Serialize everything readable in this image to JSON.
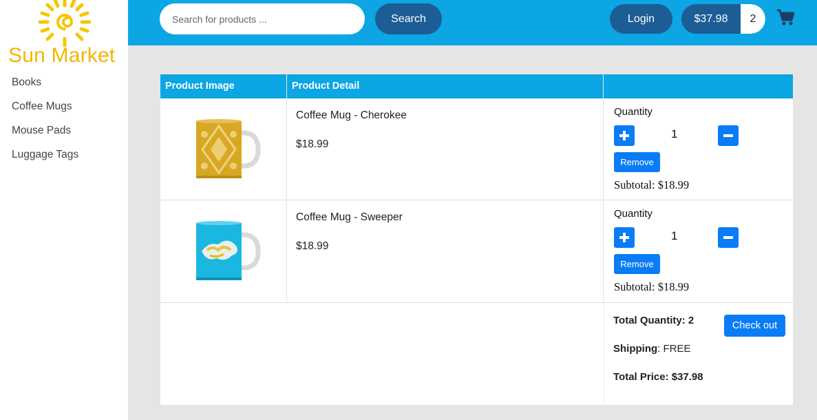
{
  "brand": {
    "name": "Sun Market",
    "logo_icon": "sun-icon",
    "color": "#f2b600"
  },
  "sidebar": {
    "items": [
      {
        "label": "Books"
      },
      {
        "label": "Coffee Mugs"
      },
      {
        "label": "Mouse Pads"
      },
      {
        "label": "Luggage Tags"
      }
    ]
  },
  "header": {
    "background": "#0ba6e3",
    "search": {
      "placeholder": "Search for products ...",
      "value": ""
    },
    "search_button": "Search",
    "login_button": "Login",
    "cart": {
      "total": "$37.98",
      "count": "2",
      "icon": "shopping-cart-icon"
    }
  },
  "table": {
    "headers": [
      "Product Image",
      "Product Detail",
      ""
    ],
    "rows": [
      {
        "image": "mug-cherokee-image",
        "name": "Coffee Mug - Cherokee",
        "price": "$18.99",
        "quantity_label": "Quantity",
        "quantity": "1",
        "remove_label": "Remove",
        "subtotal": "Subtotal: $18.99"
      },
      {
        "image": "mug-sweeper-image",
        "name": "Coffee Mug - Sweeper",
        "price": "$18.99",
        "quantity_label": "Quantity",
        "quantity": "1",
        "remove_label": "Remove",
        "subtotal": "Subtotal: $18.99"
      }
    ]
  },
  "summary": {
    "total_quantity": "Total Quantity: 2",
    "shipping_label": "Shipping",
    "shipping_value": ": FREE",
    "total_price": "Total Price: $37.98",
    "checkout_label": "Check out"
  },
  "colors": {
    "accent": "#0ba6e3",
    "dark_button": "#1c5d95",
    "primary_button": "#0a7cf5"
  }
}
